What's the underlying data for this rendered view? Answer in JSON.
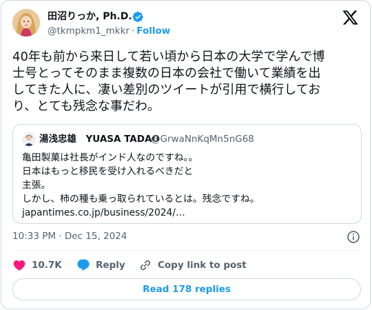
{
  "author": {
    "name": "田沼りっか, Ph.D.",
    "handle": "@tkmpkm1_mkkr",
    "separator": "·",
    "follow_label": "Follow",
    "verified_color": "#1d9bf0",
    "avatar_icon": "profile-photo"
  },
  "tweet": {
    "text": "40年も前から来日して若い頃から日本の大学で学んで博\n士号とってそのまま複数の日本の会社で働いて業績を出\nしてきた人に、凄い差別のツイートが引用で横行してお\nり、とても残念な事だわ。"
  },
  "quote": {
    "name": "湯浅忠雄　YUASA TADAO",
    "handle": "@GrwaNnKqMn5nG68",
    "text": "亀田製菓は社長がインド人なのですね。。\n日本はもっと移民を受け入れるべきだと\n主張。\nしかし、柿の種も乗っ取られているとは。残念ですね。\njapantimes.co.jp/business/2024/…"
  },
  "meta": {
    "timestamp": "10:33 PM · Dec 15, 2024"
  },
  "actions": {
    "like_count": "10.7K",
    "reply_label": "Reply",
    "copy_label": "Copy link to post",
    "like_color": "#f91880",
    "reply_color": "#1d9bf0"
  },
  "footer": {
    "read_replies_label": "Read 178 replies"
  },
  "icons": [
    "x-logo-icon",
    "verified-badge-icon",
    "info-icon",
    "heart-icon",
    "reply-bubble-icon",
    "link-icon"
  ]
}
